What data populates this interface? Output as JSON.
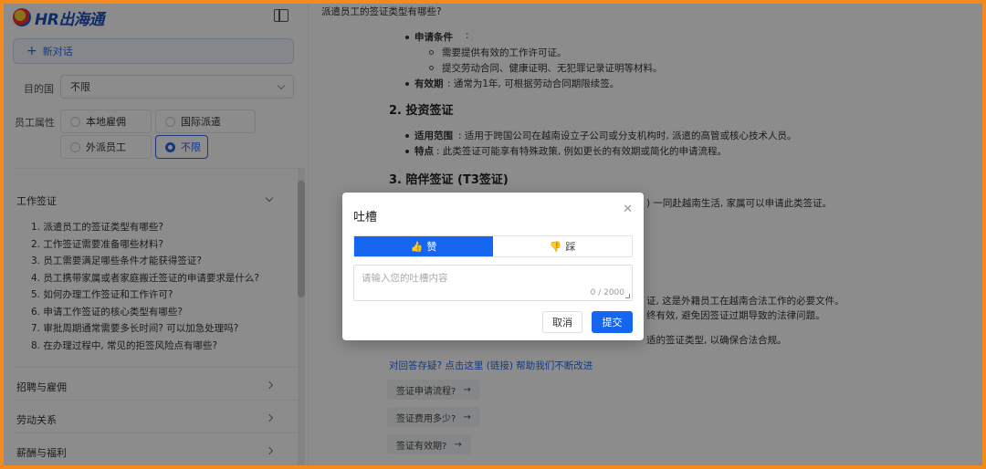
{
  "sidebar": {
    "logo_text": "HR出海通",
    "new_chat_label": "新对话",
    "destination_label": "目的国",
    "destination_value": "不限",
    "attribute_label": "员工属性",
    "attribute_options": [
      "本地雇佣",
      "国际派遣",
      "外派员工",
      "不限"
    ],
    "selected_attribute": "不限",
    "categories": [
      {
        "title": "工作签证",
        "expanded": true,
        "questions": [
          "1. 派遣员工的签证类型有哪些?",
          "2. 工作签证需要准备哪些材料?",
          "3. 员工需要满足哪些条件才能获得签证?",
          "4. 员工携带家属或者家庭搬迁签证的申请要求是什么?",
          "5. 如何办理工作签证和工作许可?",
          "6. 申请工作签证的核心类型有哪些?",
          "7. 审批周期通常需要多长时间? 可以加急处理吗?",
          "8. 在办理过程中, 常见的拒签风险点有哪些?"
        ]
      },
      {
        "title": "招聘与雇佣",
        "expanded": false
      },
      {
        "title": "劳动关系",
        "expanded": false
      },
      {
        "title": "薪酬与福利",
        "expanded": false
      }
    ]
  },
  "main": {
    "question": "派遣员工的签证类型有哪些?",
    "s1": {
      "req_label": "申请条件",
      "req_items": [
        "需要提供有效的工作许可证。",
        "提交劳动合同、健康证明、无犯罪记录证明等材料。"
      ],
      "valid_label": "有效期",
      "valid_text": ": 通常为1年, 可根据劳动合同期限续签。"
    },
    "s2": {
      "heading": "2. 投资签证",
      "scope_label": "适用范围",
      "scope_text": ": 适用于跨国公司在越南设立子公司或分支机构时, 派遣的高管或核心技术人员。",
      "feat_label": "特点",
      "feat_text": ": 此类签证可能享有特殊政策, 例如更长的有效期或简化的申请流程。"
    },
    "s3": {
      "heading": "3. 陪伴签证 (T3签证)",
      "partial_line": ") 一同赴越南生活, 家属可以申请此类签证。"
    },
    "partial_lines": [
      "证, 这是外籍员工在越南合法工作的必要文件。",
      "终有效, 避免因签证过期导致的法律问题。",
      "适的签证类型, 以确保合法合规。"
    ],
    "feedback_link": "对回答存疑? 点击这里 (链接) 帮助我们不断改进",
    "suggestions": [
      "签证申请流程?",
      "签证费用多少?",
      "签证有效期?"
    ]
  },
  "modal": {
    "title": "吐槽",
    "like_label": "赞",
    "dislike_label": "踩",
    "selected": "like",
    "placeholder": "请输入您的吐槽内容",
    "counter": "0 / 2000",
    "cancel_label": "取消",
    "submit_label": "提交"
  },
  "colors": {
    "accent": "#1565f0",
    "frame": "#f28a1e"
  }
}
